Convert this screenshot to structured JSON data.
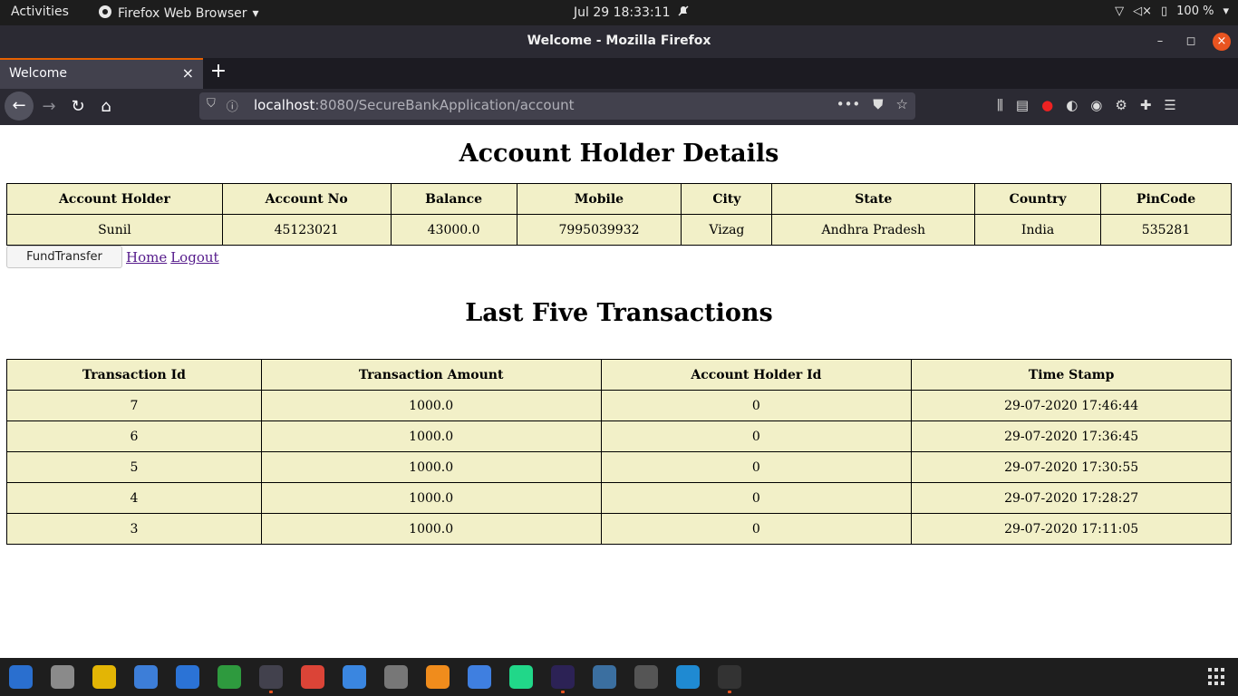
{
  "system": {
    "activities": "Activities",
    "app_name": "Firefox Web Browser",
    "clock": "Jul 29  18:33:11",
    "battery": "100 %"
  },
  "window": {
    "title": "Welcome - Mozilla Firefox"
  },
  "browser": {
    "tab_title": "Welcome",
    "url_host": "localhost",
    "url_rest": ":8080/SecureBankApplication/account"
  },
  "page": {
    "account_heading": "Account Holder Details",
    "account_table": {
      "headers": [
        "Account Holder",
        "Account No",
        "Balance",
        "Mobile",
        "City",
        "State",
        "Country",
        "PinCode"
      ],
      "row": [
        "Sunil",
        "45123021",
        "43000.0",
        "7995039932",
        "Vizag",
        "Andhra Pradesh",
        "India",
        "535281"
      ]
    },
    "fund_transfer_label": "FundTransfer",
    "home_link": "Home",
    "logout_link": "Logout",
    "transactions_heading": "Last Five Transactions",
    "transactions_table": {
      "headers": [
        "Transaction Id",
        "Transaction Amount",
        "Account Holder Id",
        "Time Stamp"
      ],
      "rows": [
        [
          "7",
          "1000.0",
          "0",
          "29-07-2020 17:46:44"
        ],
        [
          "6",
          "1000.0",
          "0",
          "29-07-2020 17:36:45"
        ],
        [
          "5",
          "1000.0",
          "0",
          "29-07-2020 17:30:55"
        ],
        [
          "4",
          "1000.0",
          "0",
          "29-07-2020 17:28:27"
        ],
        [
          "3",
          "1000.0",
          "0",
          "29-07-2020 17:11:05"
        ]
      ]
    }
  },
  "dock": {
    "apps": [
      {
        "icon": "thunderbird-icon",
        "color": "#2a6fcf"
      },
      {
        "icon": "files-icon",
        "color": "#8a8a8a"
      },
      {
        "icon": "rhythmbox-icon",
        "color": "#e3b505"
      },
      {
        "icon": "screenshot-icon",
        "color": "#3d7ed8"
      },
      {
        "icon": "writer-icon",
        "color": "#2b73d6"
      },
      {
        "icon": "calc-icon",
        "color": "#2e9a3e"
      },
      {
        "icon": "firefox-icon",
        "color": "#ff7139"
      },
      {
        "icon": "chrome-icon",
        "color": "#db4437"
      },
      {
        "icon": "help-icon",
        "color": "#3a86e0"
      },
      {
        "icon": "settings-icon",
        "color": "#777777"
      },
      {
        "icon": "sublime-icon",
        "color": "#f08c1c"
      },
      {
        "icon": "text-editor-icon",
        "color": "#3f7fe0"
      },
      {
        "icon": "pycharm-icon",
        "color": "#21d789"
      },
      {
        "icon": "eclipse-icon",
        "color": "#2c2255"
      },
      {
        "icon": "mysql-workbench-icon",
        "color": "#3b6fa0"
      },
      {
        "icon": "software-updater-icon",
        "color": "#555555"
      },
      {
        "icon": "vscode-icon",
        "color": "#1f8ad2"
      },
      {
        "icon": "terminal-icon",
        "color": "#333333"
      }
    ]
  }
}
